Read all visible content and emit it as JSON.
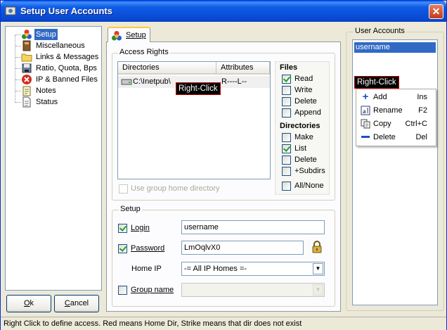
{
  "window": {
    "title": "Setup User Accounts",
    "close_glyph": "✕"
  },
  "tree": {
    "items": [
      {
        "label": "Setup",
        "icon": "colored-balls-icon",
        "selected": true
      },
      {
        "label": "Miscellaneous",
        "icon": "book-icon"
      },
      {
        "label": "Links & Messages",
        "icon": "folder-icon"
      },
      {
        "label": "Ratio, Quota, Bps",
        "icon": "disk-icon"
      },
      {
        "label": "IP & Banned Files",
        "icon": "banned-icon"
      },
      {
        "label": "Notes",
        "icon": "notepad-icon"
      },
      {
        "label": "Status",
        "icon": "document-icon"
      }
    ]
  },
  "buttons": {
    "ok_label": "Ok",
    "ok_mnemonic": "O",
    "ok_rest": "k",
    "cancel_label": "Cancel",
    "cancel_mnemonic": "C",
    "cancel_rest": "ancel"
  },
  "tab": {
    "label": "Setup"
  },
  "access_rights": {
    "title": "Access Rights",
    "columns": [
      "Directories",
      "Attributes"
    ],
    "rows": [
      {
        "directory": "C:\\Inetpub\\",
        "attributes": "R----L--"
      }
    ],
    "use_group_home_label": "Use group home directory"
  },
  "files": {
    "title": "Files",
    "options": [
      {
        "label": "Read",
        "checked": true
      },
      {
        "label": "Write",
        "checked": false
      },
      {
        "label": "Delete",
        "checked": false
      },
      {
        "label": "Append",
        "checked": false
      }
    ]
  },
  "directories": {
    "title": "Directories",
    "options": [
      {
        "label": "Make",
        "checked": false
      },
      {
        "label": "List",
        "checked": true
      },
      {
        "label": "Delete",
        "checked": false
      },
      {
        "label": "+Subdirs",
        "checked": false
      }
    ],
    "all_none_label": "All/None"
  },
  "setup": {
    "title": "Setup",
    "login_label": "Login",
    "login_value": "username",
    "password_label": "Password",
    "password_value": "LmOqlvX0",
    "home_ip_label": "Home IP",
    "home_ip_value": "-= All IP Homes =-",
    "group_name_label": "Group name",
    "group_name_value": ""
  },
  "user_accounts": {
    "title": "User Accounts",
    "users": [
      "username"
    ]
  },
  "right_click_label": "Right-Click",
  "context_menu": {
    "items": [
      {
        "label": "Add",
        "shortcut": "Ins",
        "icon": "plus-icon"
      },
      {
        "label": "Rename",
        "shortcut": "F2",
        "icon": "rename-icon"
      },
      {
        "label": "Copy",
        "shortcut": "Ctrl+C",
        "icon": "copy-icon"
      },
      {
        "label": "Delete",
        "shortcut": "Del",
        "icon": "minus-icon"
      }
    ]
  },
  "status_bar": {
    "text": "Right Click to define access. Red means Home Dir, Strike means that dir does not exist"
  },
  "colors": {
    "selection": "#316AC5",
    "titlebar": "#0A4FD8",
    "right_click_bg": "#000000"
  }
}
